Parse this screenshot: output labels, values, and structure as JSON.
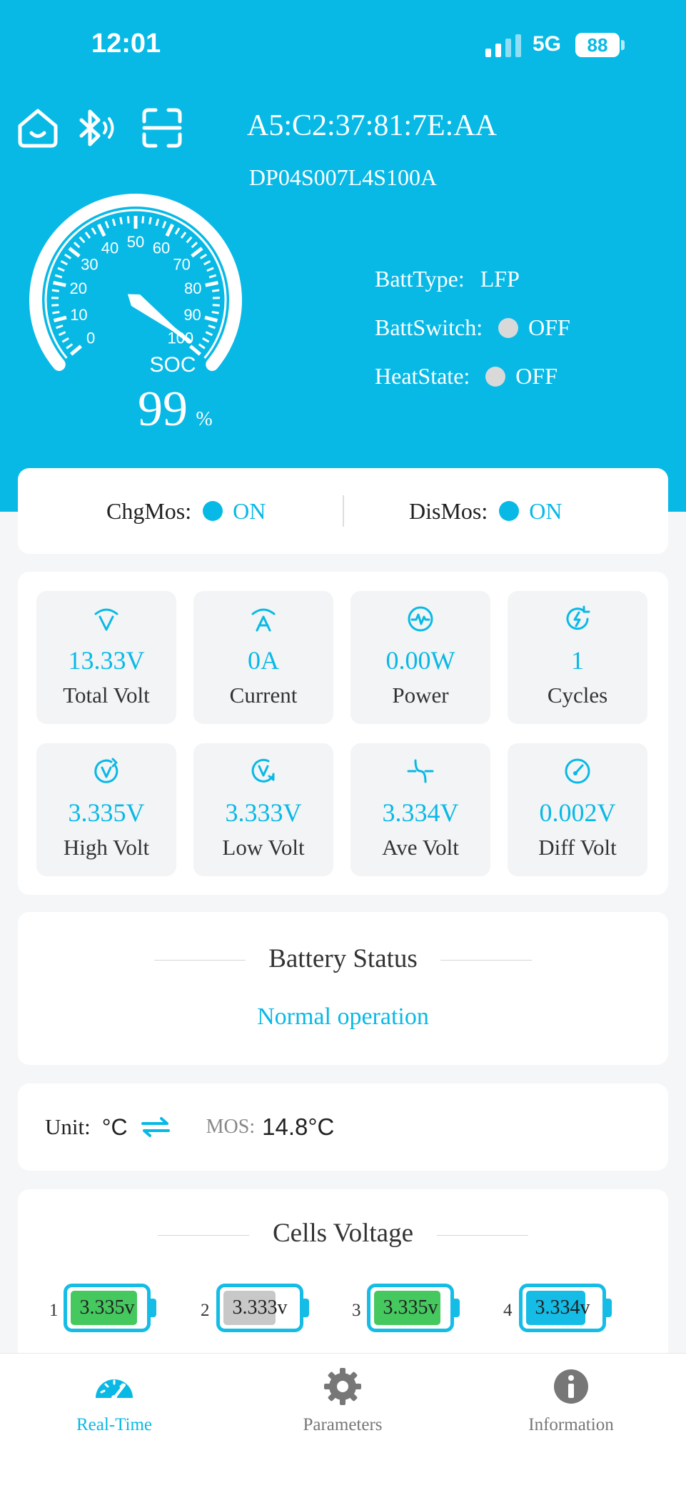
{
  "status_bar": {
    "time": "12:01",
    "network": "5G",
    "battery": "88"
  },
  "header": {
    "icons": [
      "home-icon",
      "bluetooth-icon",
      "scan-icon"
    ],
    "mac": "A5:C2:37:81:7E:AA",
    "model": "DP04S007L4S100A"
  },
  "gauge": {
    "label": "SOC",
    "value": "99",
    "unit": "%",
    "soc_fraction": 0.99,
    "ticks": [
      "0",
      "10",
      "20",
      "30",
      "40",
      "50",
      "60",
      "70",
      "80",
      "90",
      "100"
    ]
  },
  "info": {
    "batt_type_label": "BattType:",
    "batt_type": "LFP",
    "batt_switch_label": "BattSwitch:",
    "batt_switch": "OFF",
    "heat_state_label": "HeatState:",
    "heat_state": "OFF",
    "off_color": "#d9d9d9"
  },
  "mos": {
    "chg_label": "ChgMos:",
    "chg_value": "ON",
    "dis_label": "DisMos:",
    "dis_value": "ON",
    "on_color": "#08b9e6"
  },
  "metrics": [
    {
      "icon": "volt-icon",
      "value": "13.33V",
      "label": "Total Volt"
    },
    {
      "icon": "current-icon",
      "value": "0A",
      "label": "Current"
    },
    {
      "icon": "power-icon",
      "value": "0.00W",
      "label": "Power"
    },
    {
      "icon": "cycles-icon",
      "value": "1",
      "label": "Cycles"
    },
    {
      "icon": "high-volt-icon",
      "value": "3.335V",
      "label": "High Volt"
    },
    {
      "icon": "low-volt-icon",
      "value": "3.333V",
      "label": "Low Volt"
    },
    {
      "icon": "ave-volt-icon",
      "value": "3.334V",
      "label": "Ave Volt"
    },
    {
      "icon": "diff-volt-icon",
      "value": "0.002V",
      "label": "Diff Volt"
    }
  ],
  "battery_status": {
    "title": "Battery Status",
    "value": "Normal operation"
  },
  "temperature": {
    "unit_label": "Unit:",
    "unit": "°C",
    "mos_label": "MOS:",
    "mos_value": "14.8°C"
  },
  "cells": {
    "title": "Cells Voltage",
    "items": [
      {
        "index": "1",
        "voltage": "3.335v",
        "color": "#45c95f"
      },
      {
        "index": "2",
        "voltage": "3.333v",
        "color": "#c8c8c8"
      },
      {
        "index": "3",
        "voltage": "3.335v",
        "color": "#45c95f"
      },
      {
        "index": "4",
        "voltage": "3.334v",
        "color": "#14bce6"
      }
    ]
  },
  "tabs": [
    {
      "label": "Real-Time",
      "icon": "speedometer-icon",
      "active": true
    },
    {
      "label": "Parameters",
      "icon": "gear-icon",
      "active": false
    },
    {
      "label": "Information",
      "icon": "info-icon",
      "active": false
    }
  ],
  "colors": {
    "brand": "#08b9e6"
  }
}
